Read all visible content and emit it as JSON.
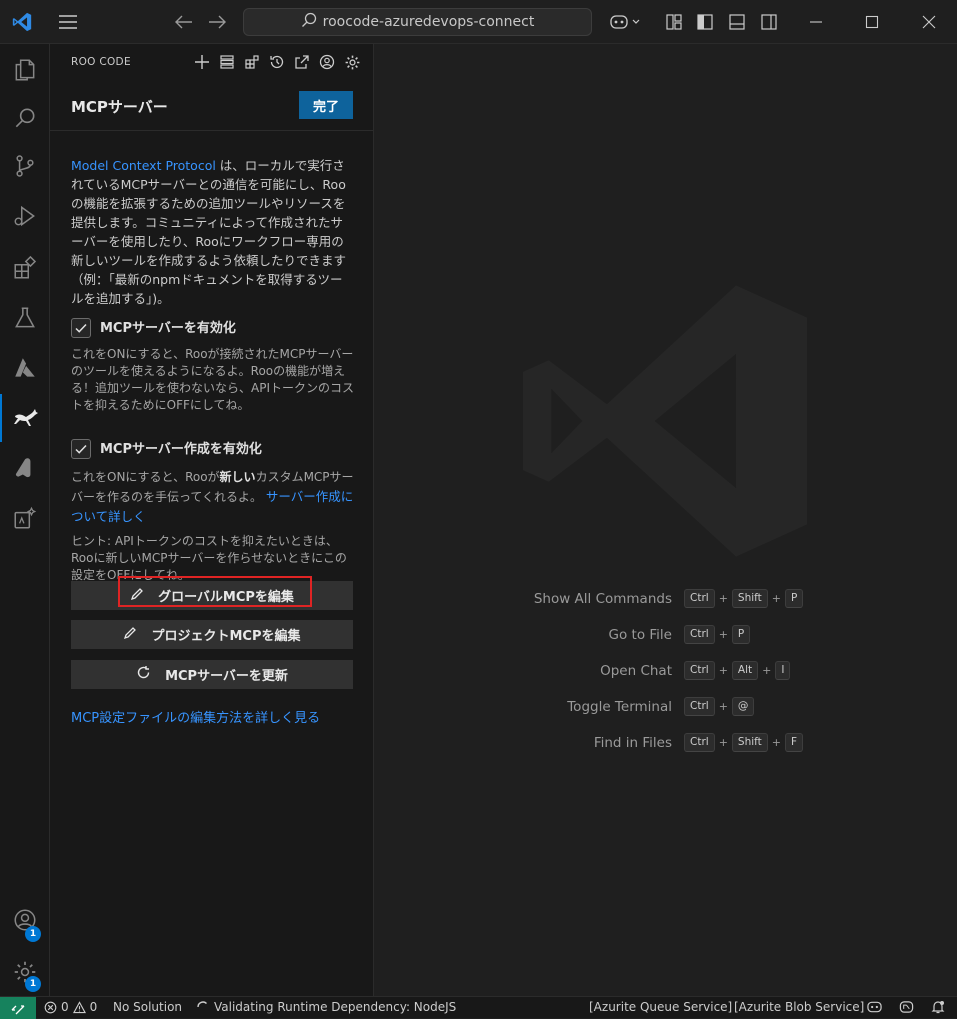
{
  "titlebar": {
    "search_text": "roocode-azuredevops-connect"
  },
  "activitybar": {
    "accounts_badge": "1",
    "settings_badge": "1"
  },
  "sidebar": {
    "title": "ROO CODE",
    "page_title": "MCPサーバー",
    "done_label": "完了",
    "intro_link": "Model Context Protocol",
    "intro_text": " は、ローカルで実行されているMCPサーバーとの通信を可能にし、Rooの機能を拡張するための追加ツールやリソースを提供します。コミュニティによって作成されたサーバーを使用したり、Rooにワークフロー専用の新しいツールを作成するよう依頼したりできます（例：「最新のnpmドキュメントを取得するツールを追加する」)。",
    "enable_mcp_label": "MCPサーバーを有効化",
    "enable_mcp_desc": "これをONにすると、Rooが接続されたMCPサーバーのツールを使えるようになるよ。Rooの機能が増える！追加ツールを使わないなら、APIトークンのコストを抑えるためにOFFにしてね。",
    "enable_create_label": "MCPサーバー作成を有効化",
    "enable_create_desc_1": "これをONにすると、Rooが",
    "enable_create_desc_bold": "新しい",
    "enable_create_desc_2": "カスタムMCPサーバーを作るのを手伝ってくれるよ。 ",
    "enable_create_link": "サーバー作成について詳しく",
    "hint_text": "ヒント: APIトークンのコストを抑えたいときは、Rooに新しいMCPサーバーを作らせないときにこの設定をOFFにしてね。",
    "edit_global_label": "グローバルMCPを編集",
    "edit_project_label": "プロジェクトMCPを編集",
    "refresh_label": "MCPサーバーを更新",
    "bottom_link": "MCP設定ファイルの編集方法を詳しく見る"
  },
  "editor": {
    "shortcuts": [
      {
        "label": "Show All Commands",
        "keys": [
          "Ctrl",
          "Shift",
          "P"
        ]
      },
      {
        "label": "Go to File",
        "keys": [
          "Ctrl",
          "P"
        ]
      },
      {
        "label": "Open Chat",
        "keys": [
          "Ctrl",
          "Alt",
          "I"
        ]
      },
      {
        "label": "Toggle Terminal",
        "keys": [
          "Ctrl",
          "@"
        ]
      },
      {
        "label": "Find in Files",
        "keys": [
          "Ctrl",
          "Shift",
          "F"
        ]
      }
    ]
  },
  "statusbar": {
    "errors": "0",
    "warnings": "0",
    "solution": "No Solution",
    "validating": "Validating Runtime Dependency: NodeJS",
    "queue_service": "[Azurite Queue Service]",
    "blob_service": "[Azurite Blob Service]"
  },
  "colors": {
    "accent": "#0078d4",
    "button_primary": "#0e639c",
    "link": "#3794ff",
    "highlight_box": "#e02424",
    "remote_indicator": "#16825d"
  }
}
